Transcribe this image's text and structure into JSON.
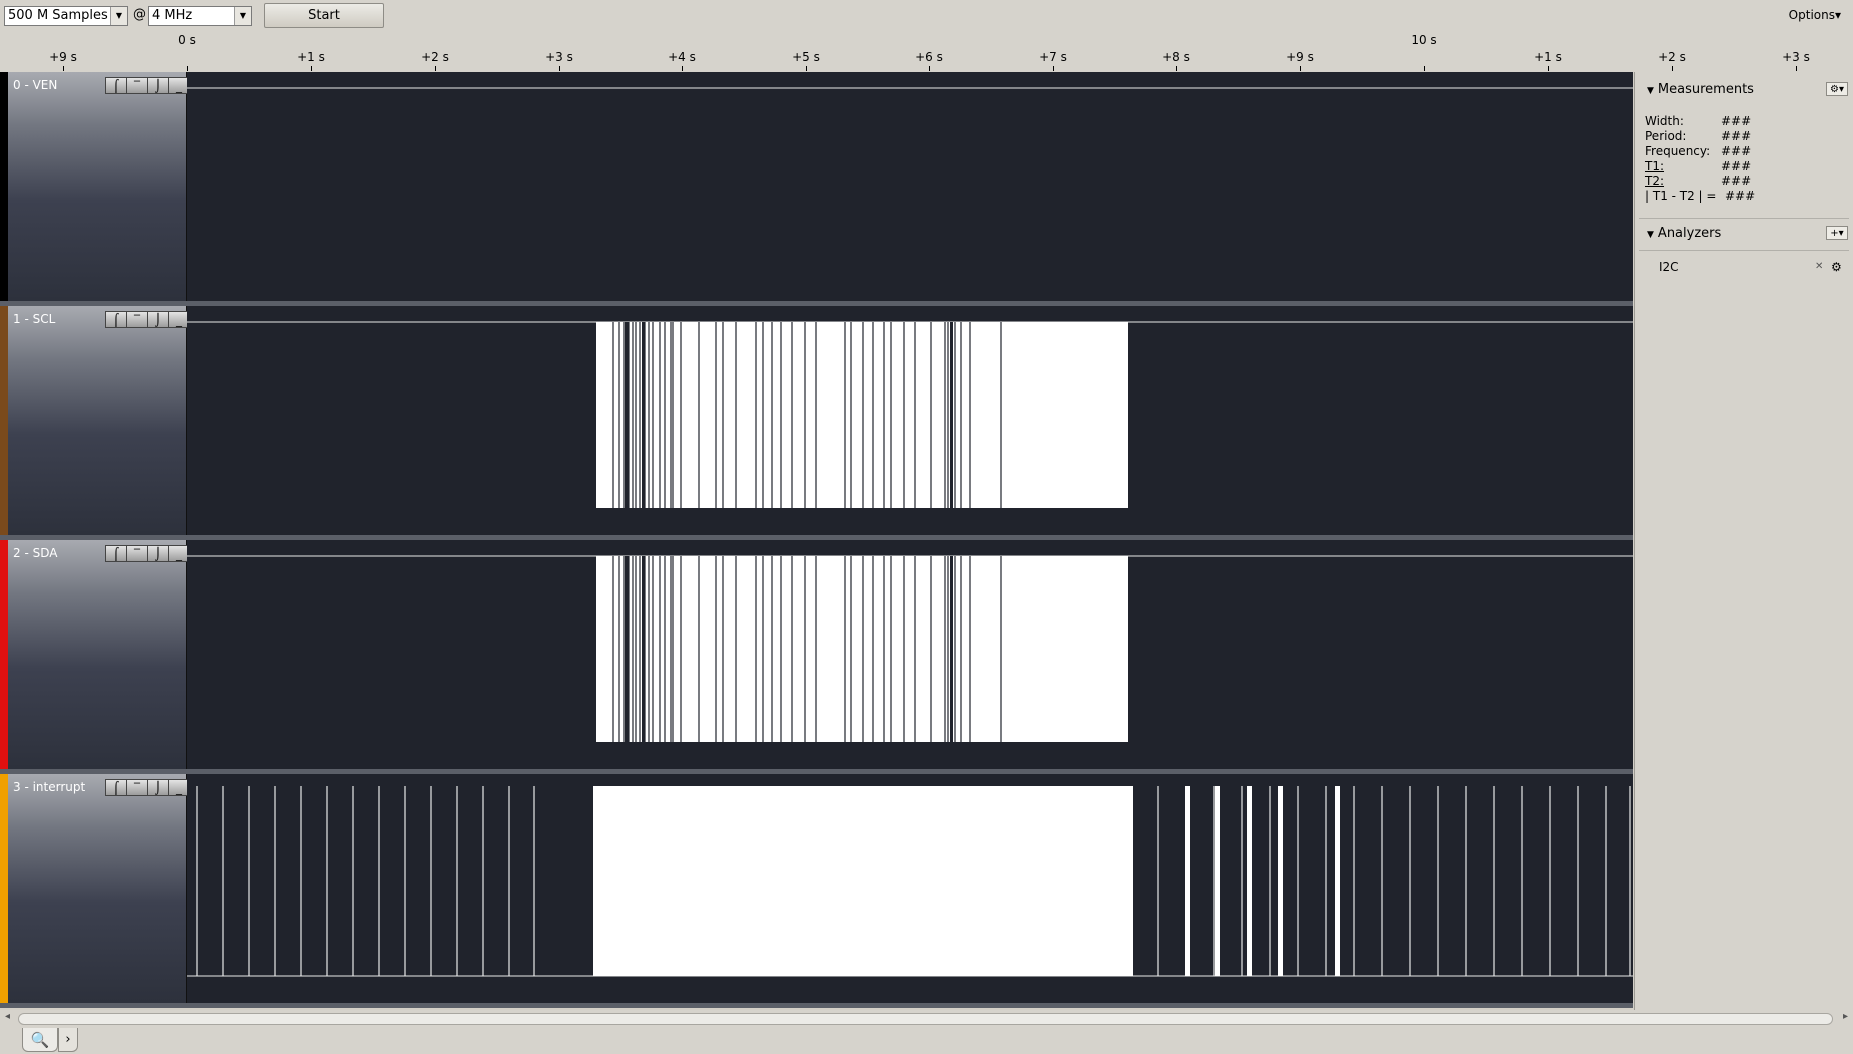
{
  "toolbar": {
    "samples_value": "500 M Samples",
    "at_symbol": "@",
    "rate_value": "4 MHz",
    "start_label": "Start",
    "options_label": "Options▾"
  },
  "ruler": {
    "ticks": [
      {
        "label": "+9 s"
      },
      {
        "label": "0 s"
      },
      {
        "label": "+1 s"
      },
      {
        "label": "+2 s"
      },
      {
        "label": "+3 s"
      },
      {
        "label": "+4 s"
      },
      {
        "label": "+5 s"
      },
      {
        "label": "+6 s"
      },
      {
        "label": "+7 s"
      },
      {
        "label": "+8 s"
      },
      {
        "label": "+9 s"
      },
      {
        "label": "10 s"
      },
      {
        "label": "+1 s"
      },
      {
        "label": "+2 s"
      },
      {
        "label": "+3 s"
      }
    ]
  },
  "channels": [
    {
      "name": "0 - VEN",
      "color": "#000000"
    },
    {
      "name": "1 - SCL",
      "color": "#7a4a1c"
    },
    {
      "name": "2 - SDA",
      "color": "#e01010"
    },
    {
      "name": "3 - interrupt",
      "color": "#f0a000"
    }
  ],
  "channel_buttons": {
    "rising": "⌠",
    "high": "‾",
    "falling": "⌡",
    "low": "_"
  },
  "measurements": {
    "title": "Measurements",
    "rows": [
      {
        "label": "Width:",
        "value": "###"
      },
      {
        "label": "Period:",
        "value": "###"
      },
      {
        "label": "Frequency:",
        "value": "###"
      },
      {
        "label": "T1:",
        "value": "###"
      },
      {
        "label": "T2:",
        "value": "###"
      },
      {
        "label": "| T1 - T2 | =",
        "value": "###"
      }
    ]
  },
  "analyzers": {
    "title": "Analyzers",
    "items": [
      {
        "name": "I2C"
      }
    ]
  },
  "icons": {
    "gear": "gear-icon",
    "add": "add-icon",
    "search": "search-icon",
    "close": "close-icon"
  }
}
